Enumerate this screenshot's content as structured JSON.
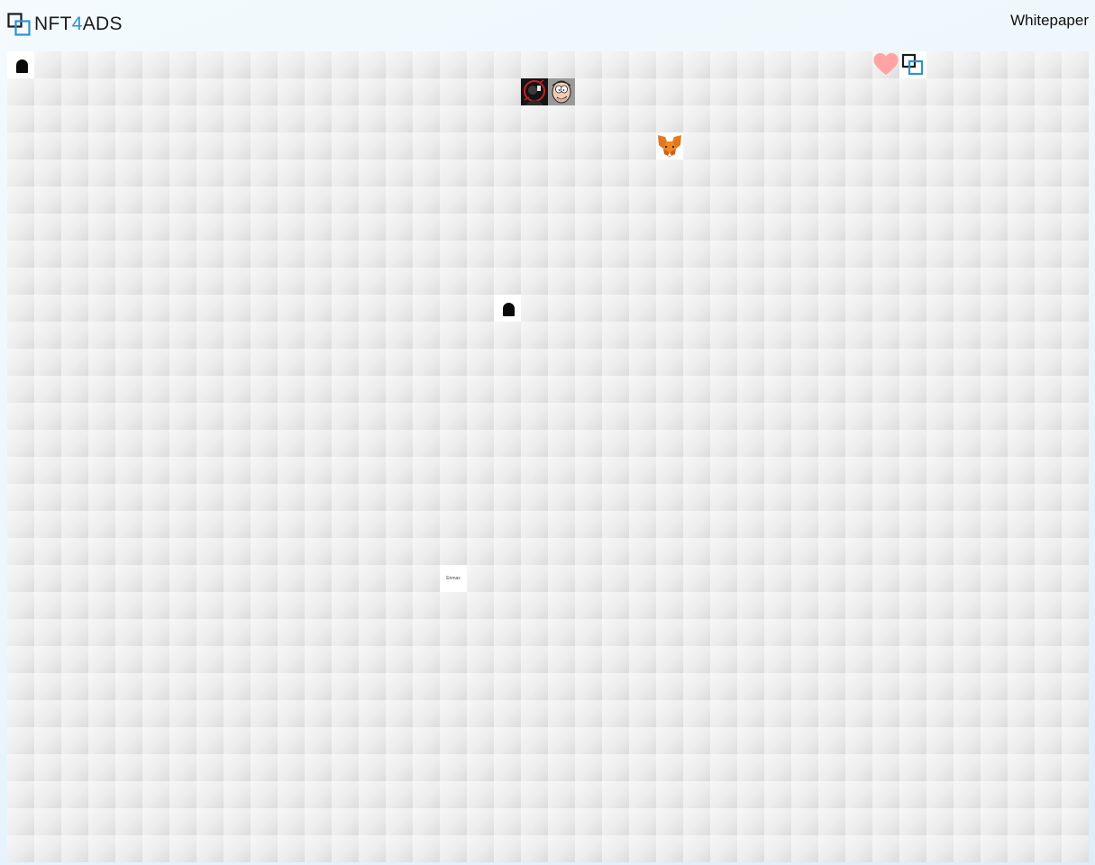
{
  "header": {
    "logo": {
      "text_prefix": "NFT",
      "text_accent": "4",
      "text_suffix": "ADS"
    },
    "nav": {
      "whitepaper": "Whitepaper"
    }
  },
  "grid": {
    "columns": 40,
    "rows": 30,
    "tiles": [
      {
        "name": "tile-tombstone-icon",
        "col": 0,
        "row": 0,
        "icon": "tombstone-icon"
      },
      {
        "name": "tile-avatar-dark",
        "col": 19,
        "row": 1,
        "icon": "dark-avatar-icon"
      },
      {
        "name": "tile-cartoon-face",
        "col": 20,
        "row": 1,
        "icon": "cartoon-face-icon"
      },
      {
        "name": "tile-heart",
        "col": 32,
        "row": 0,
        "icon": "heart-icon"
      },
      {
        "name": "tile-nft4ads-logo",
        "col": 33,
        "row": 0,
        "icon": "nft4ads-logo-icon"
      },
      {
        "name": "tile-metamask-fox",
        "col": 24,
        "row": 3,
        "icon": "metamask-fox-icon"
      },
      {
        "name": "tile-tombstone-icon",
        "col": 18,
        "row": 9,
        "icon": "tombstone-icon"
      },
      {
        "name": "tile-text-ad",
        "col": 16,
        "row": 19,
        "icon": "text-ad",
        "label": "Enmax"
      }
    ]
  },
  "colors": {
    "accent": "#2a93d5",
    "heart": "#ffa3a3",
    "fox": "#e2761b"
  }
}
